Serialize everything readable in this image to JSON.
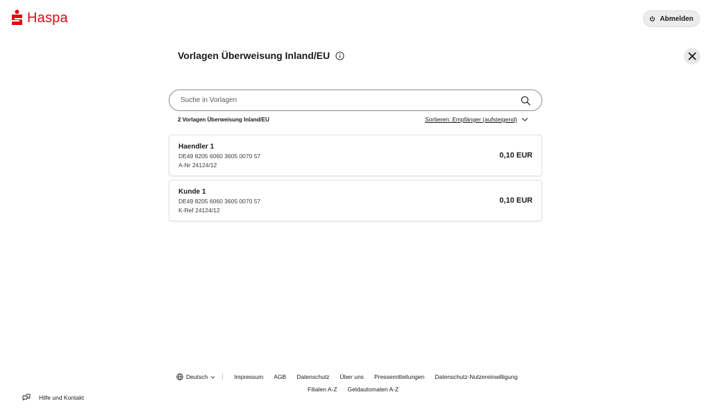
{
  "header": {
    "brand": "Haspa",
    "logout_label": "Abmelden"
  },
  "page": {
    "title": "Vorlagen Überweisung Inland/EU"
  },
  "search": {
    "placeholder": "Suche in Vorlagen",
    "value": ""
  },
  "list": {
    "count_label": "2 Vorlagen Überweisung Inland/EU",
    "sort_label": "Sortieren: Empfänger (aufsteigend)",
    "items": [
      {
        "name": "Haendler 1",
        "iban": "DE49 8205 6060 3605 0070 57",
        "reference": "A-Nr 24124/12",
        "amount": "0,10 EUR"
      },
      {
        "name": "Kunde 1",
        "iban": "DE49 8205 6060 3605 0070 57",
        "reference": "K-Ref 24124/12",
        "amount": "0,10 EUR"
      }
    ]
  },
  "footer": {
    "language": "Deutsch",
    "links_row1": [
      "Impressum",
      "AGB",
      "Datenschutz",
      "Über uns",
      "Pressemitteilungen",
      "Datenschutz-Nutzereinwilligung"
    ],
    "links_row2": [
      "Filialen A-Z",
      "Geldautomaten A-Z"
    ],
    "help_label": "Hilfe und Kontakt"
  },
  "colors": {
    "brand_red": "#e30613"
  },
  "icons": {
    "logo": "sparkasse-s-icon",
    "logout": "power-icon",
    "info": "info-circle-icon",
    "close": "close-icon",
    "search": "search-icon",
    "sort": "chevron-down-icon",
    "language": "globe-icon",
    "help": "chat-bubbles-icon"
  }
}
